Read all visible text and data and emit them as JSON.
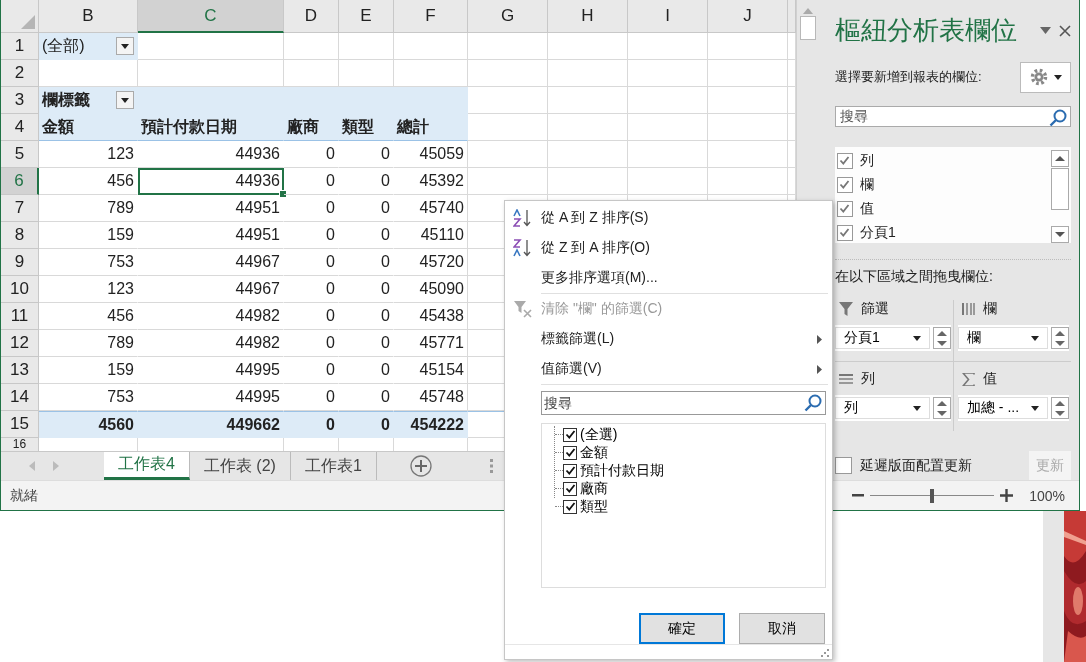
{
  "sheet": {
    "columns": [
      {
        "label": "B",
        "selected": false
      },
      {
        "label": "C",
        "selected": true
      },
      {
        "label": "D",
        "selected": false
      },
      {
        "label": "E",
        "selected": false
      },
      {
        "label": "F",
        "selected": false
      },
      {
        "label": "G",
        "selected": false
      },
      {
        "label": "H",
        "selected": false
      },
      {
        "label": "I",
        "selected": false
      },
      {
        "label": "J",
        "selected": false
      }
    ],
    "rows": [
      {
        "number": "1",
        "selected": false,
        "kind": "filter",
        "cells": [
          "(全部)"
        ]
      },
      {
        "number": "2",
        "selected": false,
        "kind": "empty",
        "cells": []
      },
      {
        "number": "3",
        "selected": false,
        "kind": "label",
        "cells": [
          "欄標籤"
        ]
      },
      {
        "number": "4",
        "selected": false,
        "kind": "header",
        "cells": [
          "金額",
          "預計付款日期",
          "廠商",
          "類型",
          "總計"
        ]
      },
      {
        "number": "5",
        "selected": false,
        "kind": "data",
        "cells": [
          "123",
          "44936",
          "0",
          "0",
          "45059"
        ]
      },
      {
        "number": "6",
        "selected": true,
        "kind": "data",
        "cells": [
          "456",
          "44936",
          "0",
          "0",
          "45392"
        ]
      },
      {
        "number": "7",
        "selected": false,
        "kind": "data",
        "cells": [
          "789",
          "44951",
          "0",
          "0",
          "45740"
        ]
      },
      {
        "number": "8",
        "selected": false,
        "kind": "data",
        "cells": [
          "159",
          "44951",
          "0",
          "0",
          "45110"
        ]
      },
      {
        "number": "9",
        "selected": false,
        "kind": "data",
        "cells": [
          "753",
          "44967",
          "0",
          "0",
          "45720"
        ]
      },
      {
        "number": "10",
        "selected": false,
        "kind": "data",
        "cells": [
          "123",
          "44967",
          "0",
          "0",
          "45090"
        ]
      },
      {
        "number": "11",
        "selected": false,
        "kind": "data",
        "cells": [
          "456",
          "44982",
          "0",
          "0",
          "45438"
        ]
      },
      {
        "number": "12",
        "selected": false,
        "kind": "data",
        "cells": [
          "789",
          "44982",
          "0",
          "0",
          "45771"
        ]
      },
      {
        "number": "13",
        "selected": false,
        "kind": "data",
        "cells": [
          "159",
          "44995",
          "0",
          "0",
          "45154"
        ]
      },
      {
        "number": "14",
        "selected": false,
        "kind": "data",
        "cells": [
          "753",
          "44995",
          "0",
          "0",
          "45748"
        ]
      },
      {
        "number": "15",
        "selected": false,
        "kind": "total",
        "cells": [
          "4560",
          "449662",
          "0",
          "0",
          "454222"
        ]
      },
      {
        "number": "16",
        "selected": false,
        "kind": "empty",
        "cells": []
      }
    ]
  },
  "sheet_tabs": [
    {
      "label": "工作表4",
      "selected": true
    },
    {
      "label": "工作表 (2)",
      "selected": false
    },
    {
      "label": "工作表1",
      "selected": false
    }
  ],
  "status_bar": {
    "text": "就緒",
    "zoom": "100%",
    "zoom_slider": {
      "level": 0.5
    }
  },
  "pivot_fields": {
    "title": "樞紐分析表欄位",
    "subtitle": "選擇要新增到報表的欄位:",
    "search_placeholder": "搜尋",
    "fields": [
      {
        "label": "列",
        "checked": true
      },
      {
        "label": "欄",
        "checked": true
      },
      {
        "label": "值",
        "checked": true
      },
      {
        "label": "分頁1",
        "checked": true
      }
    ],
    "areas_label": "在以下區域之間拖曳欄位:",
    "areas": [
      {
        "kind": "filters",
        "label": "篩選",
        "value": "分頁1"
      },
      {
        "kind": "columns",
        "label": "欄",
        "value": "欄"
      },
      {
        "kind": "rows",
        "label": "列",
        "value": "列"
      },
      {
        "kind": "values",
        "label": "值",
        "value": "加總 - ..."
      }
    ],
    "defer_update": {
      "label": "延遲版面配置更新",
      "checked": false
    },
    "update_button": {
      "label": "更新",
      "disabled": true
    }
  },
  "filter_menu": {
    "items": [
      {
        "kind": "sort-az",
        "label": "從 A 到 Z 排序(S)",
        "disabled": false,
        "submenu": false
      },
      {
        "kind": "sort-za",
        "label": "從 Z 到 A 排序(O)",
        "disabled": false,
        "submenu": false
      },
      {
        "kind": "command",
        "label": "更多排序選項(M)...",
        "disabled": false,
        "submenu": false
      },
      {
        "kind": "separator"
      },
      {
        "kind": "clear-filter",
        "label": "清除 \"欄\" 的篩選(C)",
        "disabled": true,
        "submenu": false
      },
      {
        "kind": "command",
        "label": "標籤篩選(L)",
        "disabled": false,
        "submenu": true
      },
      {
        "kind": "command",
        "label": "值篩選(V)",
        "disabled": false,
        "submenu": true
      },
      {
        "kind": "separator"
      }
    ],
    "search_placeholder": "搜尋",
    "values": [
      {
        "label": "(全選)",
        "checked": true
      },
      {
        "label": "金額",
        "checked": true
      },
      {
        "label": "預計付款日期",
        "checked": true
      },
      {
        "label": "廠商",
        "checked": true
      },
      {
        "label": "類型",
        "checked": true
      }
    ],
    "buttons": [
      {
        "label": "確定",
        "default": true
      },
      {
        "label": "取消",
        "default": false
      }
    ]
  }
}
